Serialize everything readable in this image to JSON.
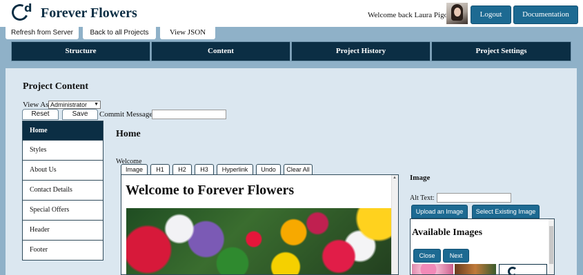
{
  "header": {
    "logo_letter": "d",
    "title": "Forever Flowers",
    "welcome": "Welcome back Laura Pigott",
    "logout": "Logout",
    "documentation": "Documentation"
  },
  "subtabs": [
    "Refresh from Server",
    "Back to all Projects",
    "View JSON"
  ],
  "nav": [
    "Structure",
    "Content",
    "Project History",
    "Project Settings"
  ],
  "content": {
    "title": "Project Content",
    "view_as_label": "View As",
    "view_as_value": "Administrator",
    "reset": "Reset",
    "save": "Save",
    "commit_label": "Commit Message:",
    "commit_value": ""
  },
  "sidebar": {
    "items": [
      "Home",
      "Styles",
      "About Us",
      "Contact Details",
      "Special Offers",
      "Header",
      "Footer"
    ],
    "active": "Home"
  },
  "page": {
    "heading": "Home",
    "field_label": "Welcome",
    "editor_tabs": [
      "Image",
      "H1",
      "H2",
      "H3",
      "Hyperlink",
      "Undo",
      "Clear All"
    ],
    "editor_heading": "Welcome to Forever Flowers"
  },
  "image_panel": {
    "title": "Image",
    "alt_label": "Alt Text:",
    "alt_value": "",
    "upload": "Upload an Image",
    "select_existing": "Select Existing Image",
    "available_title": "Available Images",
    "close": "Close",
    "next": "Next"
  },
  "colors": {
    "navy": "#0b2e44",
    "button_blue": "#1d6a92",
    "background": "#8fb1c8",
    "panel": "#dbe7f0"
  }
}
